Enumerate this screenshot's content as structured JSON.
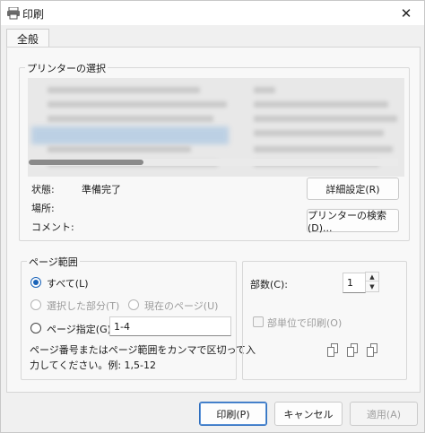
{
  "window": {
    "title": "印刷",
    "close_glyph": "✕"
  },
  "tabs": [
    {
      "label": "全般"
    }
  ],
  "printer_group": {
    "label": "プリンターの選択"
  },
  "printer_info": {
    "status_label": "状態:",
    "status_value": "準備完了",
    "location_label": "場所:",
    "comment_label": "コメント:",
    "preferences_button": "詳細設定(R)",
    "find_button": "プリンターの検索(D)..."
  },
  "page_range": {
    "label": "ページ範囲",
    "all_label": "すべて(L)",
    "selection_label": "選択した部分(T)",
    "current_label": "現在のページ(U)",
    "pages_label": "ページ指定(G):",
    "pages_value": "1-4",
    "note_line1": "ページ番号またはページ範囲をカンマで区切って入",
    "note_line2": "力してください。例: 1,5-12"
  },
  "copies": {
    "label": "部数(C):",
    "value": "1",
    "collate_label": "部単位で印刷(O)"
  },
  "footer": {
    "print_button": "印刷(P)",
    "cancel_button": "キャンセル",
    "apply_button": "適用(A)"
  },
  "colors": {
    "accent": "#1a63b8",
    "primary_border": "#2f6fbf"
  }
}
